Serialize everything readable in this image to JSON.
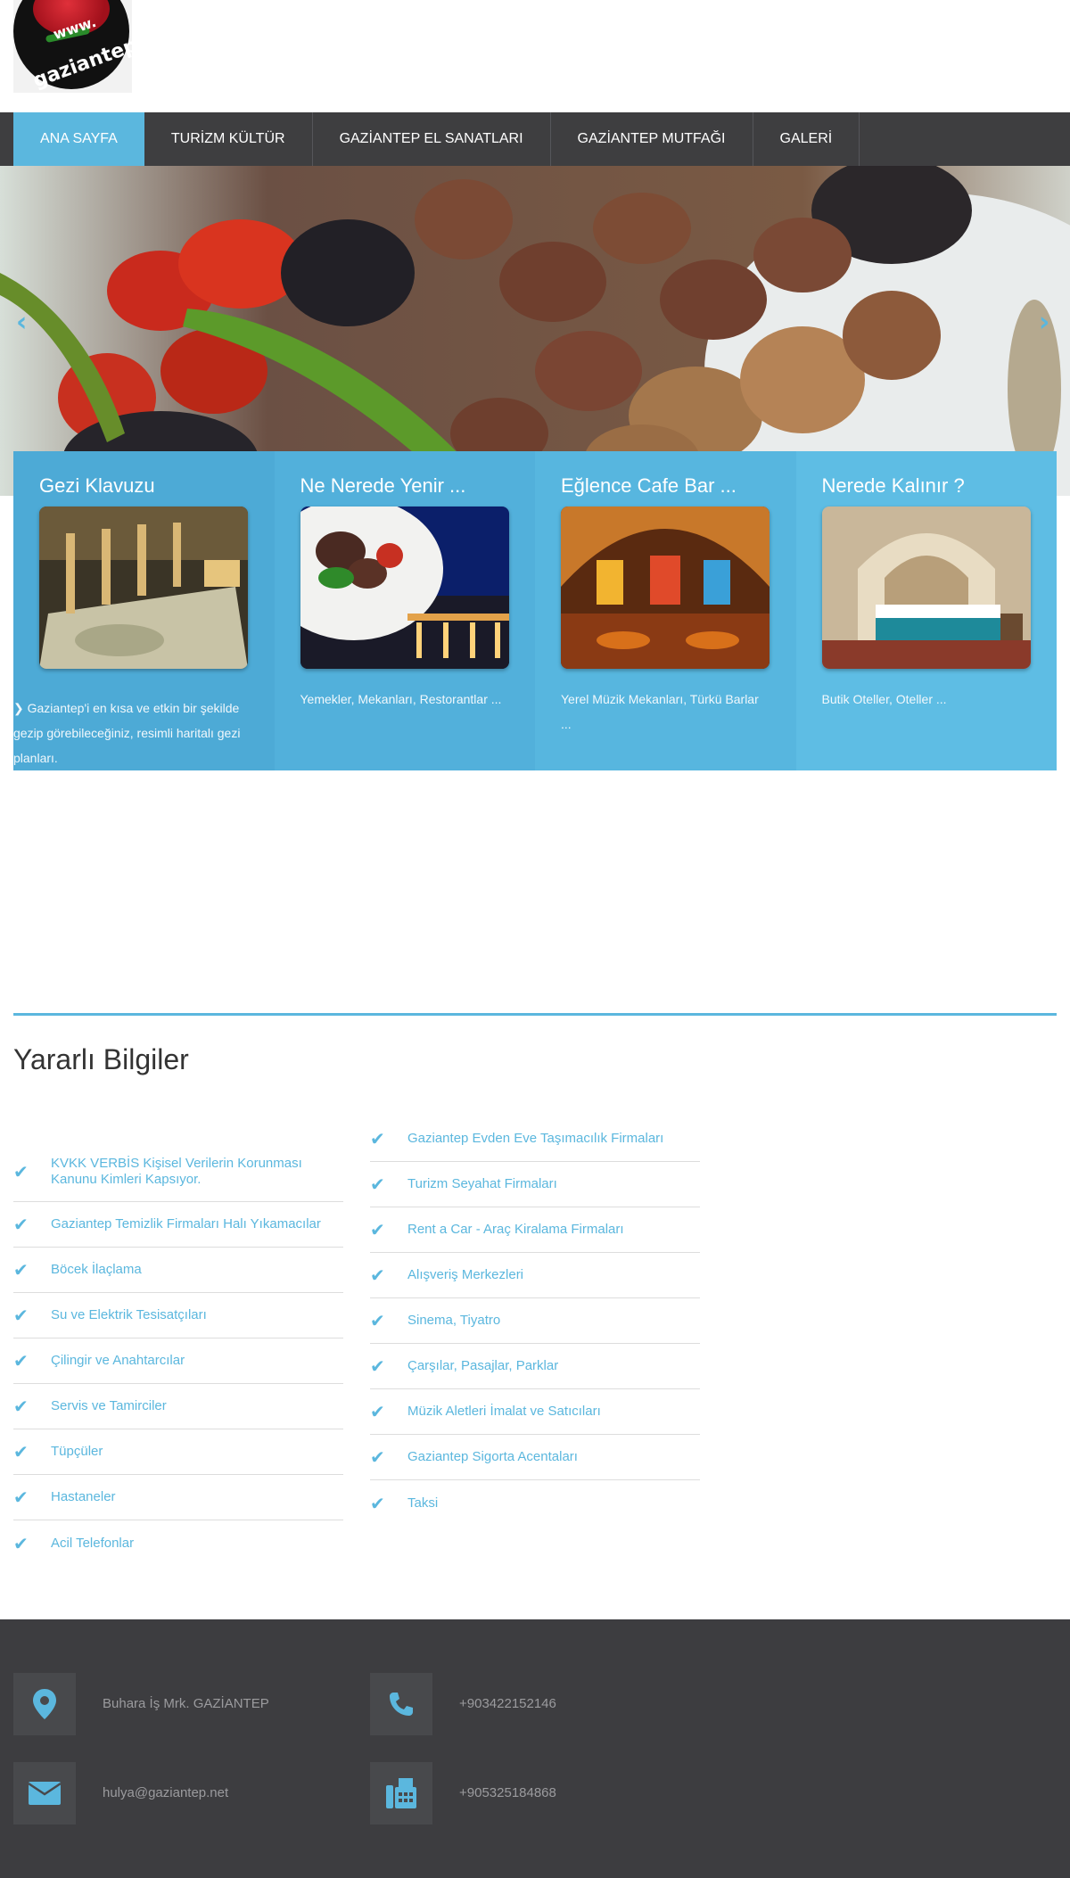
{
  "logo": {
    "top_text": "www.",
    "name": "gaziantep.net"
  },
  "nav": {
    "items": [
      {
        "label": "ANA SAYFA"
      },
      {
        "label": "TURİZM KÜLTÜR"
      },
      {
        "label": "GAZİANTEP EL SANATLARI"
      },
      {
        "label": "GAZİANTEP MUTFAĞI"
      },
      {
        "label": "GALERİ"
      }
    ],
    "active_index": 0
  },
  "slider": {
    "prev_icon": "chevron-left-icon",
    "next_icon": "chevron-right-icon",
    "prev_glyph": "‹",
    "next_glyph": "›"
  },
  "cards": [
    {
      "title": "Gezi Klavuzu",
      "text": "Gaziantep'i en kısa ve etkin bir şekilde gezip görebileceğiniz, resimli haritalı gezi planları.",
      "color": "#4daad6"
    },
    {
      "title": "Ne Nerede Yenir ...",
      "text": "Yemekler, Mekanları, Restorantlar ...",
      "color": "#52b0db"
    },
    {
      "title": "Eğlence Cafe Bar ...",
      "text": "Yerel Müzik Mekanları, Türkü Barlar ...",
      "color": "#57b6df"
    },
    {
      "title": "Nerede Kalınır ?",
      "text": "Butik Oteller, Oteller ...",
      "color": "#5ebde4"
    }
  ],
  "useful": {
    "title": "Yararlı Bilgiler",
    "left": [
      "KVKK VERBİS Kişisel Verilerin Korunması Kanunu Kimleri Kapsıyor.",
      "Gaziantep Temizlik Firmaları Halı Yıkamacılar",
      "Böcek İlaçlama",
      "Su ve Elektrik Tesisatçıları",
      "Çilingir ve Anahtarcılar",
      "Servis ve Tamirciler",
      "Tüpçüler",
      "Hastaneler",
      "Acil Telefonlar"
    ],
    "right": [
      "Gaziantep Evden Eve Taşımacılık Firmaları",
      "Turizm Seyahat Firmaları",
      "Rent a Car - Araç Kiralama Firmaları",
      "Alışveriş Merkezleri",
      "Sinema, Tiyatro",
      "Çarşılar, Pasajlar, Parklar",
      "Müzik Aletleri İmalat ve Satıcıları",
      "Gaziantep Sigorta Acentaları",
      "Taksi"
    ]
  },
  "footer": {
    "address": "Buhara İş Mrk. GAZİANTEP",
    "phone": "+903422152146",
    "email": "hulya@gaziantep.net",
    "fax": "+905325184868"
  },
  "colors": {
    "accent": "#5bb7de",
    "nav_bg": "#3e3e40",
    "footer_bg": "#3d3d40"
  }
}
